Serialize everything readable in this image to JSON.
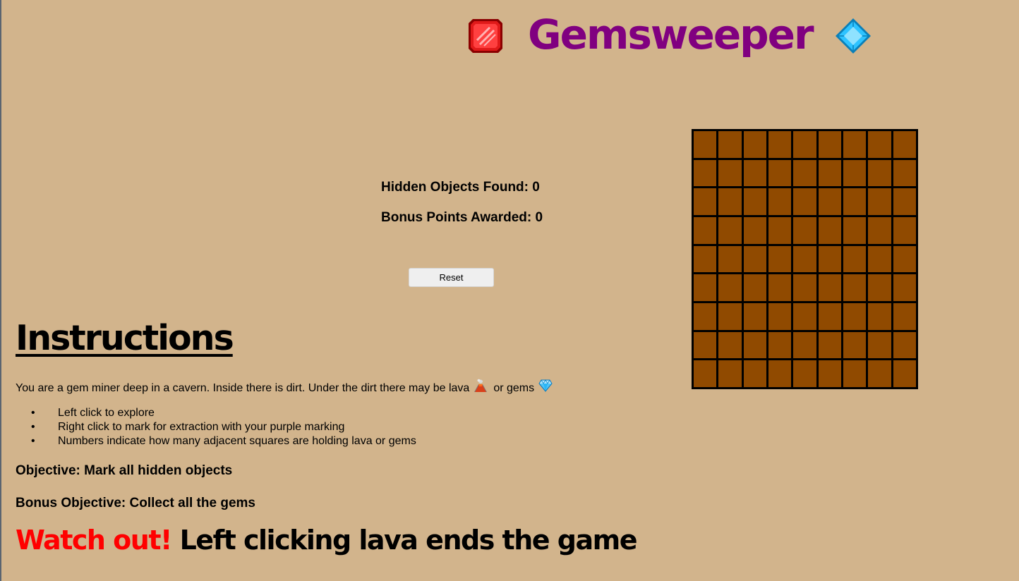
{
  "header": {
    "title": "Gemsweeper",
    "left_icon": "red-gem-icon",
    "right_icon": "blue-diamond-icon"
  },
  "stats": {
    "hidden_found": "Hidden Objects Found: 0",
    "bonus_points": "Bonus Points Awarded: 0"
  },
  "controls": {
    "reset_label": "Reset"
  },
  "board": {
    "rows": 9,
    "cols": 9,
    "cell_state": "dirt",
    "cell_color": "#904a00"
  },
  "instructions": {
    "heading": "Instructions",
    "intro_part1": "You are a gem miner deep in a cavern. Inside there is dirt. Under the dirt there may be lava",
    "intro_part2": "or gems",
    "lava_icon": "volcano-icon",
    "gem_icon": "gem-icon",
    "rules": [
      "Left click to explore",
      "Right click to mark for extraction with your purple marking",
      "Numbers indicate how many adjacent squares are holding lava or gems"
    ],
    "objective": "Objective: Mark all hidden objects",
    "bonus_objective": "Bonus Objective: Collect all the gems",
    "warning_alert": "Watch out!",
    "warning_rest": "Left clicking lava ends the game"
  },
  "colors": {
    "background": "#d2b48c",
    "title": "#800080",
    "warning": "#ff0000",
    "dirt": "#904a00"
  }
}
